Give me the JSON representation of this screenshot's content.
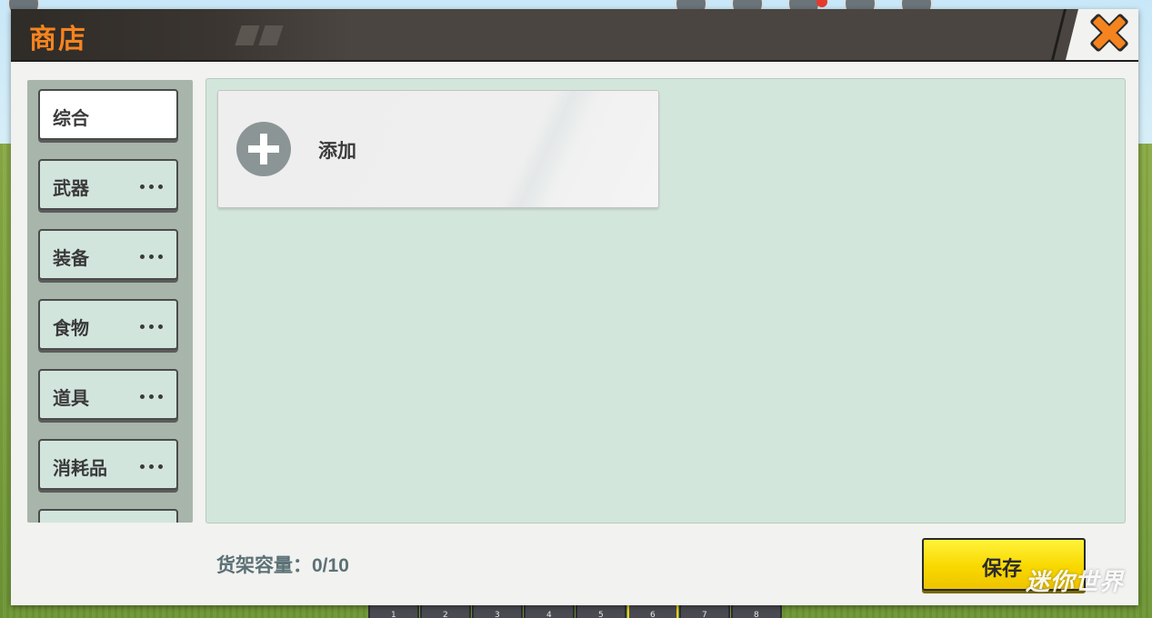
{
  "dialog": {
    "title": "商店",
    "close_icon": "close-x-icon"
  },
  "sidebar": {
    "items": [
      {
        "label": "综合",
        "active": true,
        "has_more": false
      },
      {
        "label": "武器",
        "active": false,
        "has_more": true
      },
      {
        "label": "装备",
        "active": false,
        "has_more": true
      },
      {
        "label": "食物",
        "active": false,
        "has_more": true
      },
      {
        "label": "道具",
        "active": false,
        "has_more": true
      },
      {
        "label": "消耗品",
        "active": false,
        "has_more": true
      }
    ]
  },
  "content": {
    "add_card": {
      "label": "添加",
      "icon": "plus-circle-icon"
    }
  },
  "footer": {
    "capacity_label": "货架容量：",
    "capacity_value": "0/10",
    "save_label": "保存"
  },
  "watermark": "迷你世界",
  "hotbar": {
    "slots": [
      "1",
      "2",
      "3",
      "4",
      "5",
      "6",
      "7",
      "8"
    ],
    "selected": "6"
  },
  "colors": {
    "title": "#f5841f",
    "titlebar": "#4a4540",
    "sidebar_bg": "#a7b5aa",
    "category_bg": "#d2e5dd",
    "content_bg": "#d3e6db",
    "save_button": "#f9d800",
    "close_orange": "#f5841f",
    "capacity_text": "#5b7176"
  }
}
